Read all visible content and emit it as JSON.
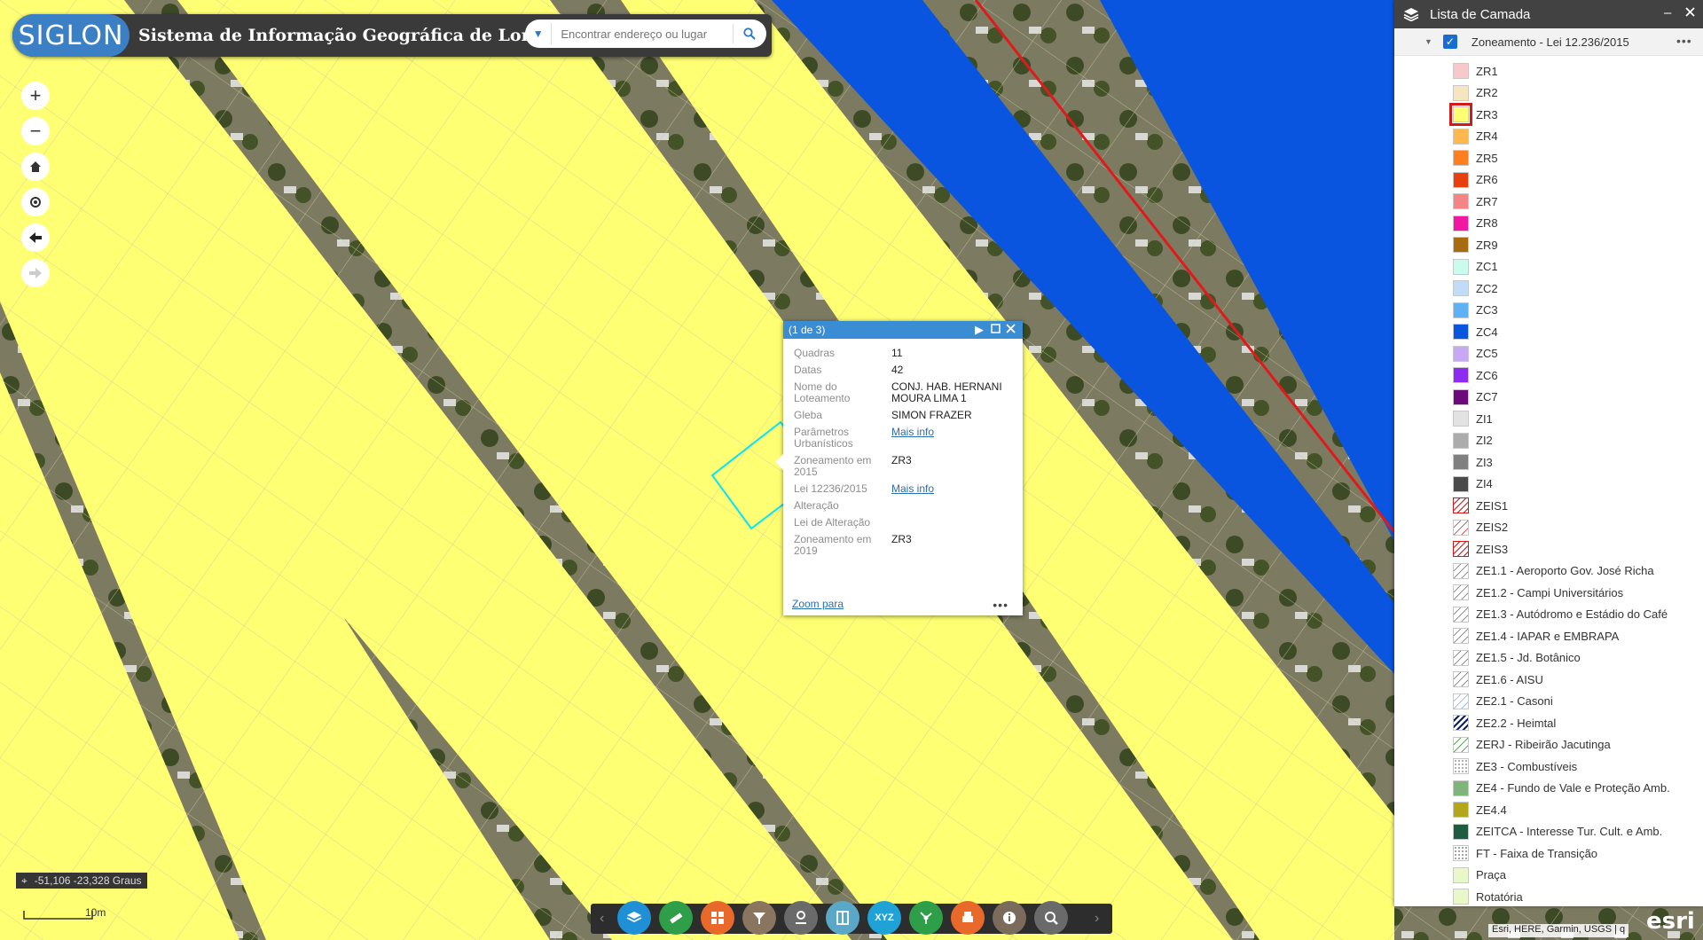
{
  "header": {
    "logo_text": "SIGLON",
    "title": "Sistema de Informação Geográfica de Londrina",
    "search_placeholder": "Encontrar endereço ou lugar"
  },
  "map_controls": {
    "zoom_in": "+",
    "zoom_out": "−"
  },
  "popup": {
    "header": "(1 de 3)",
    "fields": [
      {
        "label": "Quadras",
        "value": "11",
        "link": false
      },
      {
        "label": "Datas",
        "value": "42",
        "link": false
      },
      {
        "label": "Nome do Loteamento",
        "value": "CONJ. HAB. HERNANI MOURA LIMA 1",
        "link": false
      },
      {
        "label": "Gleba",
        "value": "SIMON FRAZER",
        "link": false
      },
      {
        "label": "Parâmetros Urbanísticos",
        "value": "Mais info",
        "link": true
      },
      {
        "label": "Zoneamento em 2015",
        "value": "ZR3",
        "link": false
      },
      {
        "label": "Lei 12236/2015",
        "value": "Mais info",
        "link": true
      },
      {
        "label": "Alteração",
        "value": "",
        "link": false
      },
      {
        "label": "Lei de Alteração",
        "value": "",
        "link": false
      },
      {
        "label": "Zoneamento em 2019",
        "value": "ZR3",
        "link": false
      }
    ],
    "zoom_link": "Zoom para",
    "more": "•••"
  },
  "layer_panel": {
    "title": "Lista de Camada",
    "layer_name": "Zoneamento - Lei 12.236/2015",
    "legend": [
      {
        "label": "ZR1",
        "color": "#f8c9c9",
        "pattern": "solid"
      },
      {
        "label": "ZR2",
        "color": "#f5e6c0",
        "pattern": "solid"
      },
      {
        "label": "ZR3",
        "color": "#ffff73",
        "pattern": "solid",
        "highlighted": true
      },
      {
        "label": "ZR4",
        "color": "#ffb84d",
        "pattern": "solid"
      },
      {
        "label": "ZR5",
        "color": "#ff7f1f",
        "pattern": "solid"
      },
      {
        "label": "ZR6",
        "color": "#e8400c",
        "pattern": "solid"
      },
      {
        "label": "ZR7",
        "color": "#f58585",
        "pattern": "solid"
      },
      {
        "label": "ZR8",
        "color": "#f216a2",
        "pattern": "solid"
      },
      {
        "label": "ZR9",
        "color": "#a86b0f",
        "pattern": "solid"
      },
      {
        "label": "ZC1",
        "color": "#c9fcec",
        "pattern": "solid"
      },
      {
        "label": "ZC2",
        "color": "#c2dcf7",
        "pattern": "solid"
      },
      {
        "label": "ZC3",
        "color": "#5eb1f2",
        "pattern": "solid"
      },
      {
        "label": "ZC4",
        "color": "#0a55e0",
        "pattern": "solid"
      },
      {
        "label": "ZC5",
        "color": "#c8a8f2",
        "pattern": "solid"
      },
      {
        "label": "ZC6",
        "color": "#8e2bf2",
        "pattern": "solid"
      },
      {
        "label": "ZC7",
        "color": "#6b0a7a",
        "pattern": "solid"
      },
      {
        "label": "ZI1",
        "color": "#e2e2e2",
        "pattern": "solid"
      },
      {
        "label": "ZI2",
        "color": "#acacac",
        "pattern": "solid"
      },
      {
        "label": "ZI3",
        "color": "#808080",
        "pattern": "solid"
      },
      {
        "label": "ZI4",
        "color": "#4b4b4b",
        "pattern": "solid"
      },
      {
        "label": "ZEIS1",
        "color": "#d11a1a",
        "pattern": "cross"
      },
      {
        "label": "ZEIS2",
        "color": "#d11a1a",
        "pattern": "hatch"
      },
      {
        "label": "ZEIS3",
        "color": "#d11a1a",
        "pattern": "cross"
      },
      {
        "label": "ZE1.1 - Aeroporto Gov. José Richa",
        "color": "#666666",
        "pattern": "hatch"
      },
      {
        "label": "ZE1.2 - Campi Universitários",
        "color": "#666666",
        "pattern": "hatch"
      },
      {
        "label": "ZE1.3 - Autódromo e Estádio do Café",
        "color": "#666666",
        "pattern": "hatch"
      },
      {
        "label": "ZE1.4 - IAPAR e EMBRAPA",
        "color": "#666666",
        "pattern": "hatch"
      },
      {
        "label": "ZE1.5 - Jd. Botânico",
        "color": "#666666",
        "pattern": "hatch"
      },
      {
        "label": "ZE1.6 - AISU",
        "color": "#666666",
        "pattern": "hatch"
      },
      {
        "label": "ZE2.1 - Casoni",
        "color": "#74a9e8",
        "pattern": "hatch"
      },
      {
        "label": "ZE2.2 - Heimtal",
        "color": "#0d1f6b",
        "pattern": "hatch-dense"
      },
      {
        "label": "ZERJ - Ribeirão Jacutinga",
        "color": "#1f7a1f",
        "pattern": "hatch"
      },
      {
        "label": "ZE3 - Combustíveis",
        "color": "#999999",
        "pattern": "dots"
      },
      {
        "label": "ZE4 - Fundo de Vale e Proteção Amb.",
        "color": "#7fb57a",
        "pattern": "solid"
      },
      {
        "label": "ZE4.4",
        "color": "#b3a61a",
        "pattern": "solid"
      },
      {
        "label": "ZEITCA - Interesse Tur. Cult. e Amb.",
        "color": "#1f5c3f",
        "pattern": "solid"
      },
      {
        "label": "FT - Faixa de Transição",
        "color": "#888888",
        "pattern": "dots"
      },
      {
        "label": "Praça",
        "color": "#eaf7c8",
        "pattern": "solid"
      },
      {
        "label": "Rotatória",
        "color": "#eaf7c8",
        "pattern": "solid"
      }
    ]
  },
  "toolbar": {
    "buttons": [
      {
        "name": "layers-icon",
        "color": "#1f90d6"
      },
      {
        "name": "measure-icon",
        "color": "#2e9e48"
      },
      {
        "name": "basemap-gallery-icon",
        "color": "#e8692a"
      },
      {
        "name": "query-icon",
        "color": "#8a7560"
      },
      {
        "name": "draw-icon",
        "color": "#6a6a6a"
      },
      {
        "name": "swipe-icon",
        "color": "#5aa7c8"
      },
      {
        "name": "xyz-coordinate-icon",
        "color": "#1fa2d6",
        "text": "XYZ"
      },
      {
        "name": "share-icon",
        "color": "#2e9e48"
      },
      {
        "name": "print-icon",
        "color": "#e8692a"
      },
      {
        "name": "info-icon",
        "color": "#7a6b5c"
      },
      {
        "name": "search-zoom-icon",
        "color": "#6a6a6a"
      }
    ]
  },
  "status": {
    "coordinates": "-51,106 -23,328 Graus",
    "scale": "10m",
    "attribution": "Esri, HERE, Garmin, USGS | q",
    "esri_logo": "esri"
  },
  "colors": {
    "zone_zr3": "#ffff73",
    "zone_zc4": "#0a55e0",
    "highlight_parcel": "#00e5ff"
  }
}
